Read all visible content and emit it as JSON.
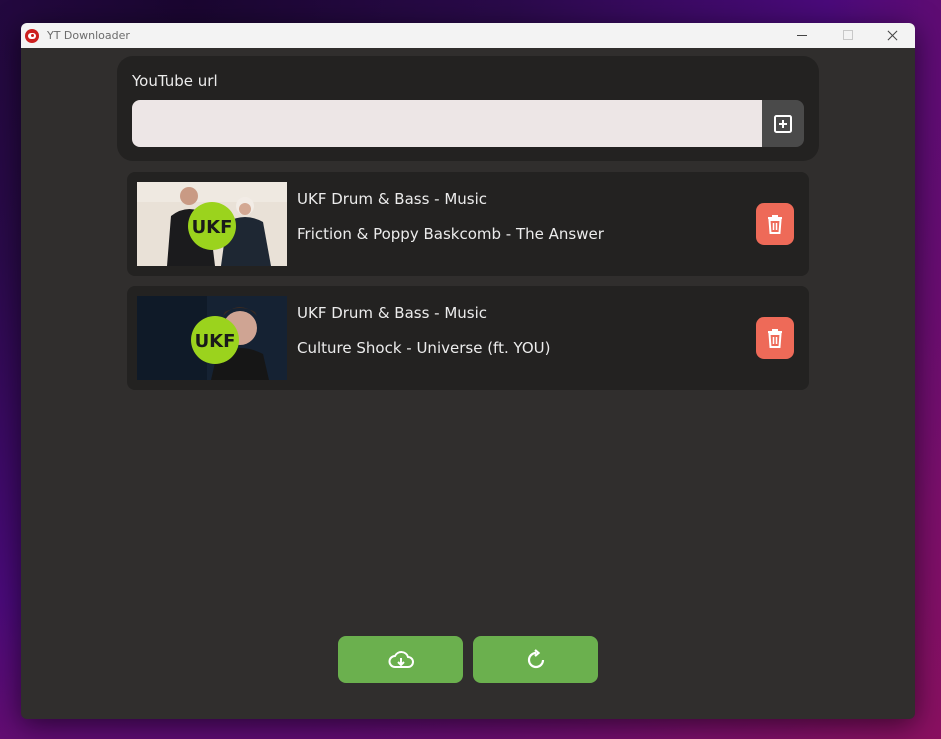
{
  "window": {
    "title": "YT Downloader"
  },
  "url_panel": {
    "label": "YouTube url",
    "input_value": "",
    "input_placeholder": ""
  },
  "videos": [
    {
      "channel": "UKF Drum & Bass - Music",
      "title": "Friction & Poppy Baskcomb - The Answer",
      "thumbnail_logo": "UKF"
    },
    {
      "channel": "UKF Drum & Bass - Music",
      "title": "Culture Shock - Universe (ft. YOU)",
      "thumbnail_logo": "UKF"
    }
  ],
  "icons": {
    "app": "youtube-icon",
    "add": "plus-square-icon",
    "delete": "trash-icon",
    "download": "cloud-download-icon",
    "refresh": "refresh-icon"
  },
  "colors": {
    "accent_green": "#6bb04e",
    "delete_red": "#ee6a58",
    "window_bg": "#302e2d",
    "panel_bg": "#232221",
    "input_bg": "#ede6e6",
    "logo_green": "#9bd31d"
  }
}
